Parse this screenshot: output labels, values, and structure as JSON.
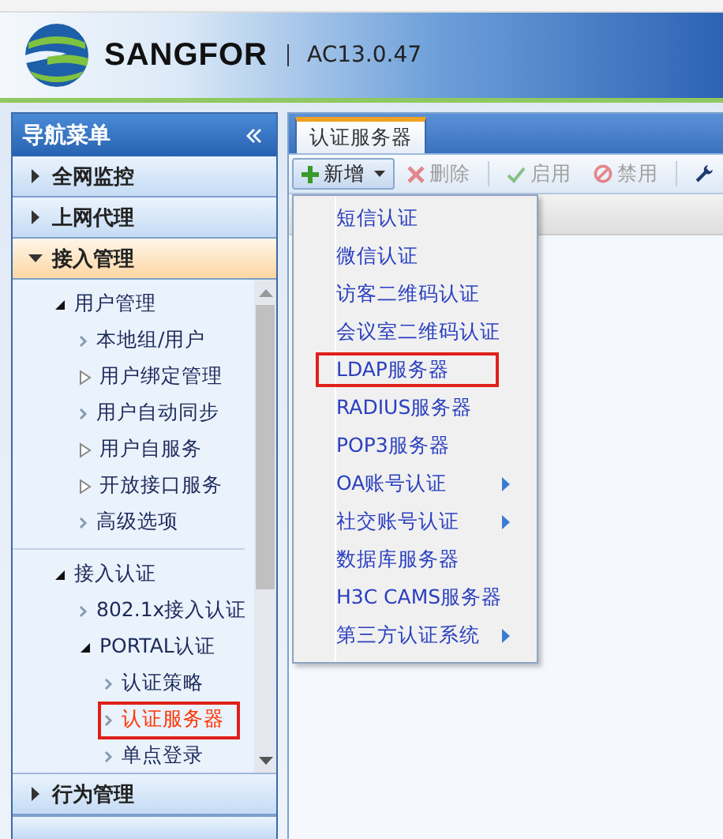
{
  "header": {
    "brand": "SANGFOR",
    "version": "AC13.0.47"
  },
  "sidebar": {
    "title": "导航菜单",
    "sections": [
      {
        "label": "全网监控",
        "expanded": false
      },
      {
        "label": "上网代理",
        "expanded": false
      },
      {
        "label": "接入管理",
        "expanded": true,
        "tree": [
          {
            "label": "用户管理",
            "kind": "folder",
            "expanded": true,
            "selected": false,
            "highlighted": false,
            "children": [
              {
                "label": "本地组/用户",
                "kind": "leaf",
                "selected": false,
                "highlighted": false
              },
              {
                "label": "用户绑定管理",
                "kind": "folder",
                "expanded": false,
                "selected": false,
                "highlighted": false
              },
              {
                "label": "用户自动同步",
                "kind": "leaf",
                "selected": false,
                "highlighted": false
              },
              {
                "label": "用户自服务",
                "kind": "folder",
                "expanded": false,
                "selected": false,
                "highlighted": false
              },
              {
                "label": "开放接口服务",
                "kind": "folder",
                "expanded": false,
                "selected": false,
                "highlighted": false
              },
              {
                "label": "高级选项",
                "kind": "leaf",
                "selected": false,
                "highlighted": false
              }
            ]
          },
          {
            "label": "接入认证",
            "kind": "folder",
            "expanded": true,
            "selected": false,
            "highlighted": false,
            "children": [
              {
                "label": "802.1x接入认证",
                "kind": "leaf",
                "selected": false,
                "highlighted": false
              },
              {
                "label": "PORTAL认证",
                "kind": "folder",
                "expanded": true,
                "selected": false,
                "highlighted": false,
                "children": [
                  {
                    "label": "认证策略",
                    "kind": "leaf",
                    "selected": false,
                    "highlighted": false
                  },
                  {
                    "label": "认证服务器",
                    "kind": "leaf",
                    "selected": true,
                    "highlighted": true
                  },
                  {
                    "label": "单点登录",
                    "kind": "leaf",
                    "selected": false,
                    "highlighted": false
                  }
                ]
              }
            ]
          }
        ]
      },
      {
        "label": "行为管理",
        "expanded": false
      }
    ]
  },
  "main": {
    "tabs": [
      {
        "label": "认证服务器",
        "selected": true
      }
    ],
    "toolbar": [
      [
        {
          "kind": "add",
          "label": "新增",
          "disabled": false,
          "open": true
        },
        {
          "kind": "delete",
          "label": "删除",
          "disabled": true
        }
      ],
      [
        {
          "kind": "enable",
          "label": "启用",
          "disabled": true
        },
        {
          "kind": "disable",
          "label": "禁用",
          "disabled": true
        }
      ],
      [
        {
          "kind": "tool",
          "disabled": false
        }
      ]
    ],
    "menu": [
      {
        "label": "短信认证",
        "submenu": false,
        "highlighted": false
      },
      {
        "label": "微信认证",
        "submenu": false,
        "highlighted": false
      },
      {
        "label": "访客二维码认证",
        "submenu": false,
        "highlighted": false
      },
      {
        "label": "会议室二维码认证",
        "submenu": false,
        "highlighted": false
      },
      {
        "label": "LDAP服务器",
        "submenu": false,
        "highlighted": true
      },
      {
        "label": "RADIUS服务器",
        "submenu": false,
        "highlighted": false
      },
      {
        "label": "POP3服务器",
        "submenu": false,
        "highlighted": false
      },
      {
        "label": "OA账号认证",
        "submenu": true,
        "highlighted": false
      },
      {
        "label": "社交账号认证",
        "submenu": true,
        "highlighted": false
      },
      {
        "label": "数据库服务器",
        "submenu": false,
        "highlighted": false
      },
      {
        "label": "H3C CAMS服务器",
        "submenu": false,
        "highlighted": false
      },
      {
        "label": "第三方认证系统",
        "submenu": true,
        "highlighted": false
      }
    ]
  }
}
